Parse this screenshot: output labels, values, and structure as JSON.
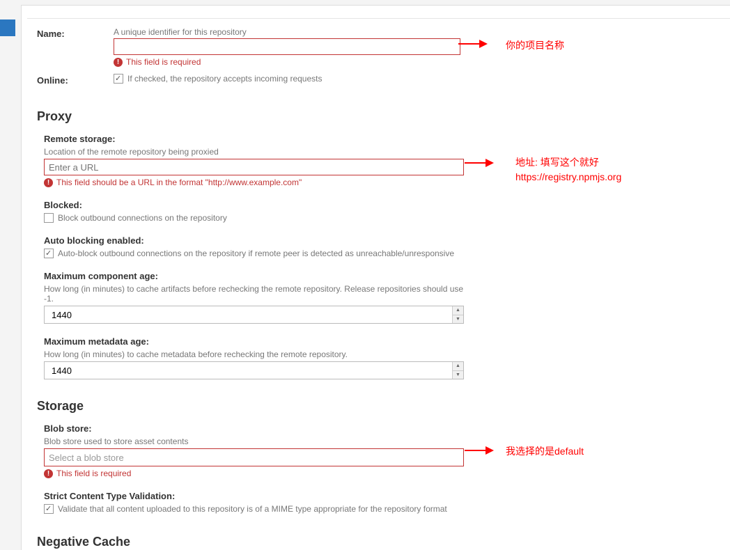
{
  "fields": {
    "name": {
      "label": "Name:",
      "helper": "A unique identifier for this repository",
      "error": "This field is required"
    },
    "online": {
      "label": "Online:",
      "checkbox": "If checked, the repository accepts incoming requests"
    }
  },
  "sections": {
    "proxy": {
      "heading": "Proxy",
      "remote_storage": {
        "label": "Remote storage:",
        "desc": "Location of the remote repository being proxied",
        "placeholder": "Enter a URL",
        "error": "This field should be a URL in the format \"http://www.example.com\""
      },
      "blocked": {
        "label": "Blocked:",
        "checkbox": "Block outbound connections on the repository"
      },
      "auto_blocking": {
        "label": "Auto blocking enabled:",
        "checkbox": "Auto-block outbound connections on the repository if remote peer is detected as unreachable/unresponsive"
      },
      "max_component_age": {
        "label": "Maximum component age:",
        "desc": "How long (in minutes) to cache artifacts before rechecking the remote repository. Release repositories should use -1.",
        "value": "1440"
      },
      "max_metadata_age": {
        "label": "Maximum metadata age:",
        "desc": "How long (in minutes) to cache metadata before rechecking the remote repository.",
        "value": "1440"
      }
    },
    "storage": {
      "heading": "Storage",
      "blob_store": {
        "label": "Blob store:",
        "desc": "Blob store used to store asset contents",
        "placeholder": "Select a blob store",
        "error": "This field is required"
      },
      "strict_validation": {
        "label": "Strict Content Type Validation:",
        "checkbox": "Validate that all content uploaded to this repository is of a MIME type appropriate for the repository format"
      }
    },
    "negative_cache": {
      "heading": "Negative Cache"
    }
  },
  "annotations": {
    "name": "你的项目名称",
    "url_line1": "地址: 填写这个就好",
    "url_line2": "https://registry.npmjs.org",
    "blob": "我选择的是default"
  }
}
